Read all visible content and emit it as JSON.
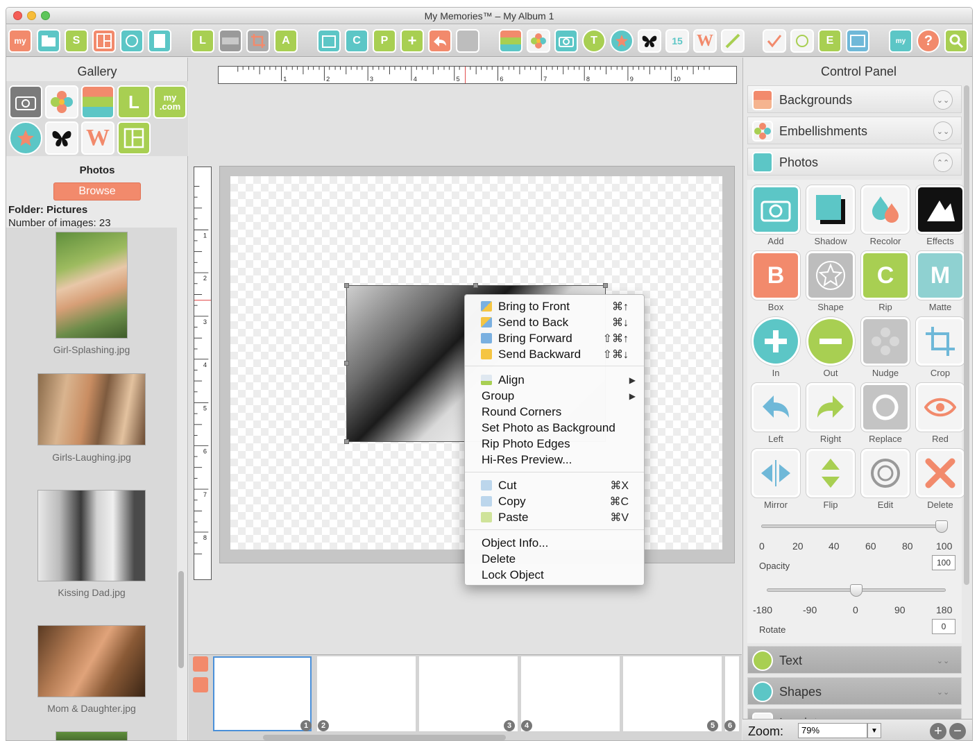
{
  "window": {
    "title": "My Memories™ – My Album 1"
  },
  "toolbar": {
    "icons": [
      "my-logo-icon",
      "folder-icon",
      "s-icon",
      "layout-icon",
      "shield-icon",
      "doc-icon",
      "l-icon",
      "ruler-icon",
      "crop-icon",
      "a-icon",
      "calendar-icon",
      "c-icon",
      "p-icon",
      "plus-icon",
      "share-icon",
      "gray-icon",
      "stripes-icon",
      "flower-icon",
      "camera-icon",
      "t-icon",
      "star-icon",
      "butterfly-icon",
      "15-icon",
      "w-icon",
      "brush-icon",
      "spell-icon",
      "print-icon",
      "e-icon",
      "pdf-icon",
      "mycom-icon",
      "help-icon",
      "search-icon"
    ],
    "labels": {
      "s": "S",
      "l": "L",
      "a": "A",
      "c": "C",
      "p": "P",
      "t": "T",
      "n15": "15",
      "w": "W",
      "e": "E",
      "my": "my"
    }
  },
  "gallery": {
    "title": "Gallery",
    "icons": {
      "my": "my",
      "com": ".com",
      "l": "L",
      "w": "W"
    },
    "section_title": "Photos",
    "browse_label": "Browse",
    "folder_label": "Folder: Pictures",
    "count_label": "Number of images: 23",
    "thumbnails": [
      {
        "caption": "Girl-Splashing.jpg"
      },
      {
        "caption": "Girls-Laughing.jpg"
      },
      {
        "caption": "Kissing Dad.jpg"
      },
      {
        "caption": "Mom & Daughter.jpg"
      }
    ]
  },
  "ruler": {
    "h_labels": [
      "1",
      "2",
      "3",
      "4",
      "5",
      "6",
      "7",
      "8",
      "9",
      "10"
    ],
    "v_labels": [
      "1",
      "2",
      "3",
      "4",
      "5",
      "6",
      "7",
      "8"
    ]
  },
  "context_menu": {
    "items": [
      {
        "label": "Bring to Front",
        "shortcut": "⌘↑",
        "icon": "bring-to-front-icon"
      },
      {
        "label": "Send to Back",
        "shortcut": "⌘↓",
        "icon": "send-to-back-icon"
      },
      {
        "label": "Bring Forward",
        "shortcut": "⇧⌘↑",
        "icon": "bring-forward-icon"
      },
      {
        "label": "Send Backward",
        "shortcut": "⇧⌘↓",
        "icon": "send-backward-icon"
      },
      {
        "label": "Align",
        "submenu": true,
        "icon": "align-icon"
      },
      {
        "label": "Group",
        "submenu": true
      },
      {
        "label": "Round Corners"
      },
      {
        "label": "Set Photo as Background"
      },
      {
        "label": "Rip Photo Edges"
      },
      {
        "label": "Hi-Res Preview..."
      },
      {
        "label": "Cut",
        "shortcut": "⌘X",
        "icon": "cut-icon"
      },
      {
        "label": "Copy",
        "shortcut": "⌘C",
        "icon": "copy-icon"
      },
      {
        "label": "Paste",
        "shortcut": "⌘V",
        "icon": "paste-icon"
      },
      {
        "label": "Object Info..."
      },
      {
        "label": "Delete"
      },
      {
        "label": "Lock Object"
      }
    ]
  },
  "pages": {
    "numbers": [
      "1",
      "2",
      "3",
      "4",
      "5",
      "6"
    ]
  },
  "control_panel": {
    "title": "Control Panel",
    "sections": [
      "Backgrounds",
      "Embellishments",
      "Photos"
    ],
    "collapsed_sections": [
      "Text",
      "Shapes",
      "Imprints"
    ],
    "tool_glyphs": {
      "box": "B",
      "matte": "M",
      "rip": "C"
    },
    "tools": [
      {
        "label": "Add",
        "icon": "camera-icon"
      },
      {
        "label": "Shadow",
        "icon": "shadow-icon"
      },
      {
        "label": "Recolor",
        "icon": "drops-icon"
      },
      {
        "label": "Effects",
        "icon": "effects-icon"
      },
      {
        "label": "Box",
        "icon": "box-icon"
      },
      {
        "label": "Shape",
        "icon": "star-shape-icon"
      },
      {
        "label": "Rip",
        "icon": "rip-icon"
      },
      {
        "label": "Matte",
        "icon": "matte-icon"
      },
      {
        "label": "In",
        "icon": "zoom-in-icon"
      },
      {
        "label": "Out",
        "icon": "zoom-out-icon"
      },
      {
        "label": "Nudge",
        "icon": "nudge-icon"
      },
      {
        "label": "Crop",
        "icon": "crop-icon"
      },
      {
        "label": "Left",
        "icon": "rotate-left-icon"
      },
      {
        "label": "Right",
        "icon": "rotate-right-icon"
      },
      {
        "label": "Replace",
        "icon": "replace-icon"
      },
      {
        "label": "Red",
        "icon": "red-eye-icon"
      },
      {
        "label": "Mirror",
        "icon": "mirror-icon"
      },
      {
        "label": "Flip",
        "icon": "flip-icon"
      },
      {
        "label": "Edit",
        "icon": "edit-icon"
      },
      {
        "label": "Delete",
        "icon": "delete-icon"
      }
    ],
    "opacity": {
      "label": "Opacity",
      "ticks": [
        "0",
        "20",
        "40",
        "60",
        "80",
        "100"
      ],
      "value": "100",
      "fraction": 1.0
    },
    "rotate": {
      "label": "Rotate",
      "ticks": [
        "-180",
        "-90",
        "0",
        "90",
        "180"
      ],
      "value": "0",
      "fraction": 0.5
    }
  },
  "zoom": {
    "label": "Zoom:",
    "value": "79%"
  },
  "colors": {
    "orange": "#f28a6c",
    "teal": "#5cc6c6",
    "green": "#a8cf52",
    "blue": "#6fb8d8",
    "gray": "#aaaaaa"
  }
}
